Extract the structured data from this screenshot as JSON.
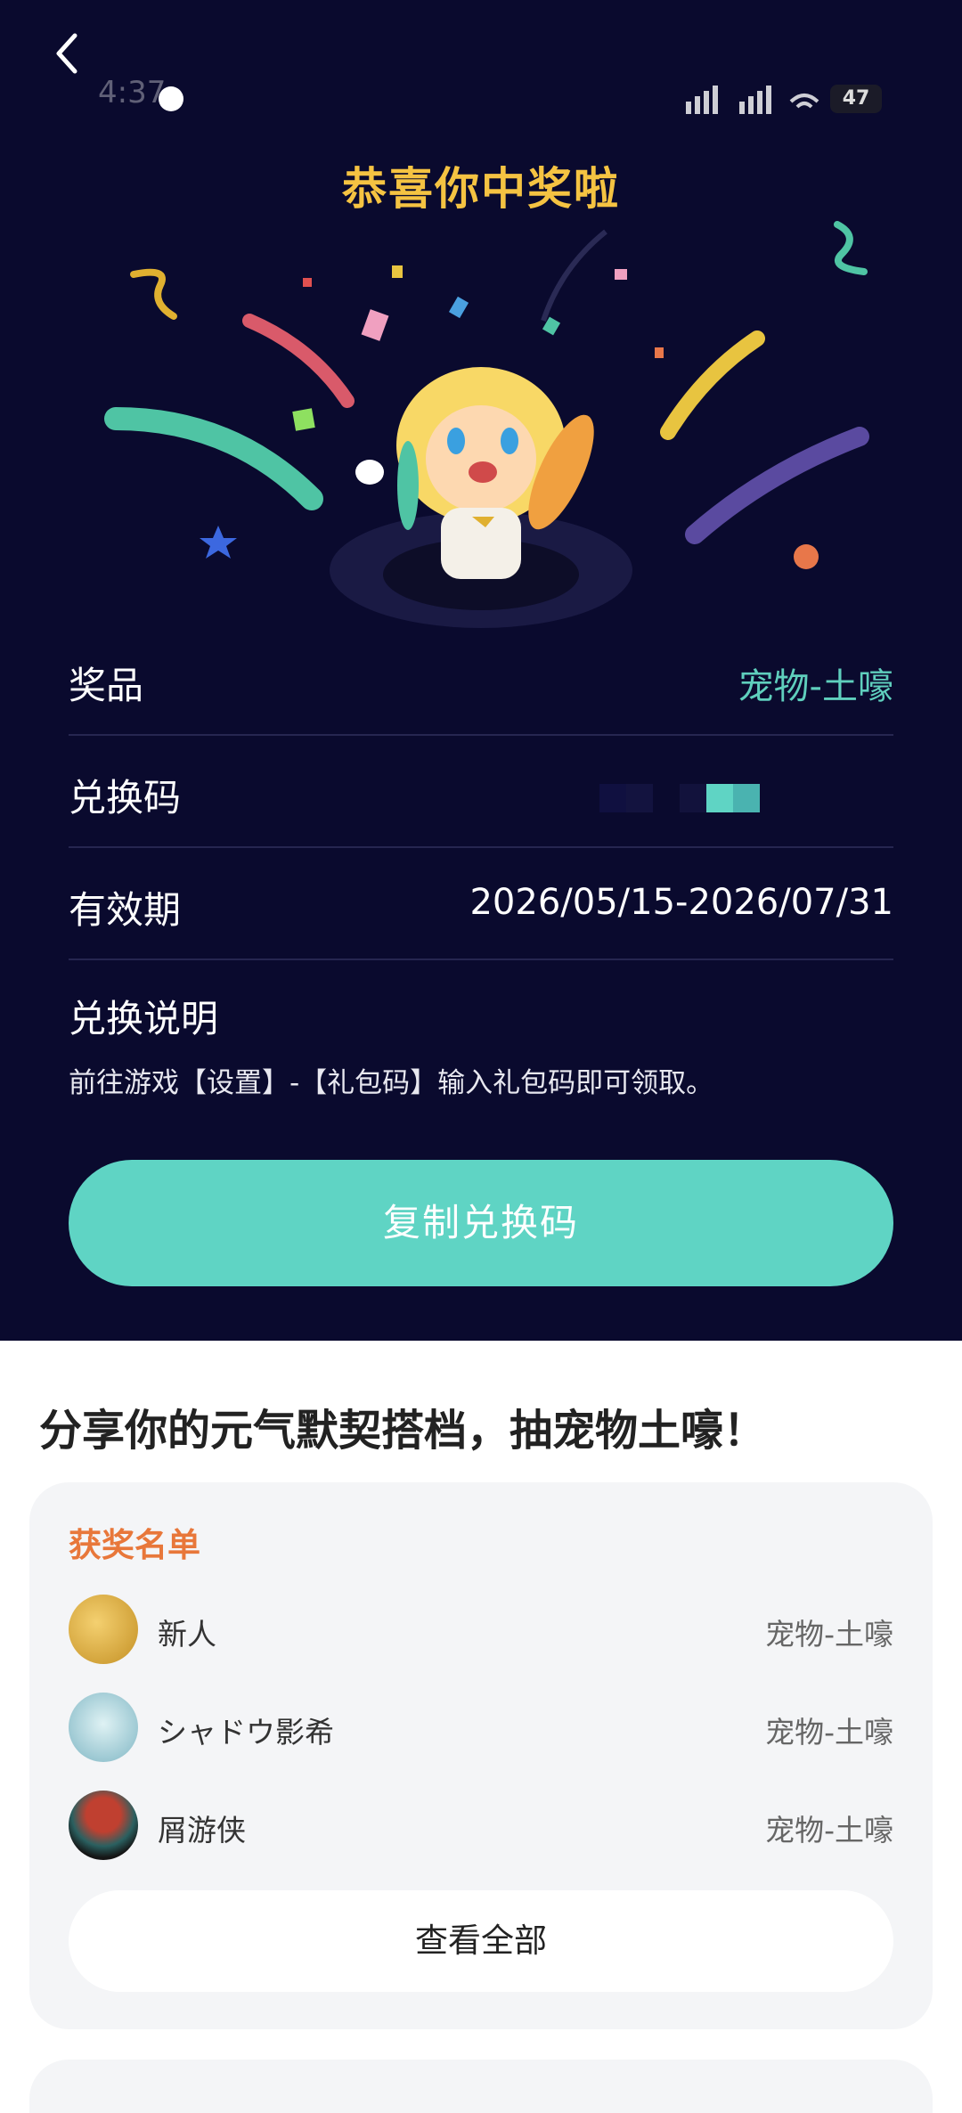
{
  "status_bar": {
    "time": "4:37",
    "battery": "47"
  },
  "header": {
    "title": "恭喜你中奖啦"
  },
  "prize_info": {
    "prize_label": "奖品",
    "prize_value": "宠物-土嚎",
    "code_label": "兑换码",
    "validity_label": "有效期",
    "validity_value": "2026/05/15-2026/07/31",
    "instructions_label": "兑换说明",
    "instructions_text": "前往游戏【设置】-【礼包码】输入礼包码即可领取。"
  },
  "copy_button": {
    "label": "复制兑换码"
  },
  "share": {
    "title": "分享你的元气默契搭档，抽宠物土嚎！"
  },
  "winners": {
    "title": "获奖名单",
    "items": [
      {
        "name": "新人",
        "prize": "宠物-土嚎"
      },
      {
        "name": "シャドウ影希",
        "prize": "宠物-土嚎"
      },
      {
        "name": "屑游侠",
        "prize": "宠物-土嚎"
      }
    ],
    "view_all_label": "查看全部"
  },
  "colors": {
    "background_dark": "#0a0a2e",
    "title_gold": "#f5c342",
    "accent_teal": "#5fd4c4",
    "winners_orange": "#e8773a"
  }
}
